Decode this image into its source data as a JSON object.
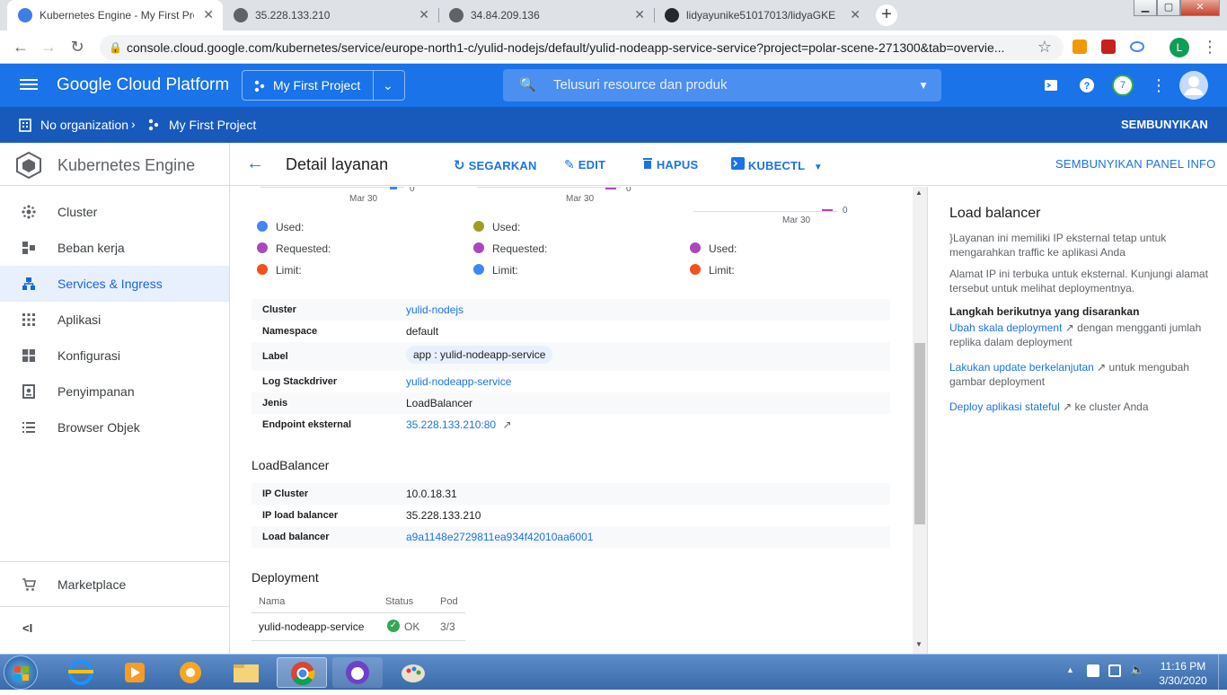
{
  "browser": {
    "tabs": [
      {
        "title": "Kubernetes Engine - My First Pro",
        "active": true,
        "icon": "kubernetes-icon"
      },
      {
        "title": "35.228.133.210",
        "active": false,
        "icon": "globe-icon"
      },
      {
        "title": "34.84.209.136",
        "active": false,
        "icon": "globe-icon"
      },
      {
        "title": "lidyayunike51017013/lidyaGKE",
        "active": false,
        "icon": "github-icon"
      }
    ],
    "url": "console.cloud.google.com/kubernetes/service/europe-north1-c/yulid-nodejs/default/yulid-nodeapp-service-service?project=polar-scene-271300&tab=overvie...",
    "profile_initial": "L"
  },
  "gcp_header": {
    "title": "Google Cloud Platform",
    "project": "My First Project",
    "search_placeholder": "Telusuri resource dan produk",
    "notification_count": "7"
  },
  "org_bar": {
    "organization": "No organization",
    "project": "My First Project",
    "hide_label": "SEMBUNYIKAN"
  },
  "left_nav": {
    "product": "Kubernetes Engine",
    "items": [
      {
        "label": "Cluster",
        "icon": "cluster-icon"
      },
      {
        "label": "Beban kerja",
        "icon": "workloads-icon"
      },
      {
        "label": "Services & Ingress",
        "icon": "services-icon",
        "selected": true
      },
      {
        "label": "Aplikasi",
        "icon": "apps-grid-icon"
      },
      {
        "label": "Konfigurasi",
        "icon": "config-icon"
      },
      {
        "label": "Penyimpanan",
        "icon": "storage-icon"
      },
      {
        "label": "Browser Objek",
        "icon": "list-icon"
      }
    ],
    "marketplace": "Marketplace",
    "collapse": "<I"
  },
  "toolbar": {
    "title": "Detail layanan",
    "refresh": "SEGARKAN",
    "edit": "EDIT",
    "delete": "HAPUS",
    "kubectl": "KUBECTL",
    "hide_panel": "SEMBUNYIKAN PANEL INFO"
  },
  "charts": {
    "tick_label": "Mar 30",
    "zero_label": "0",
    "legends": [
      [
        {
          "label": "Used:",
          "color": "#4285f4"
        },
        {
          "label": "Requested:",
          "color": "#ab47bc"
        },
        {
          "label": "Limit:",
          "color": "#f4511e"
        }
      ],
      [
        {
          "label": "Used:",
          "color": "#9e9d24"
        },
        {
          "label": "Requested:",
          "color": "#ab47bc"
        },
        {
          "label": "Limit:",
          "color": "#4285f4"
        }
      ],
      [
        {
          "label": "Used:",
          "color": "#ab47bc"
        },
        {
          "label": "Limit:",
          "color": "#f4511e"
        }
      ]
    ]
  },
  "details": {
    "rows": [
      {
        "key": "Cluster",
        "value": "yulid-nodejs",
        "link": true
      },
      {
        "key": "Namespace",
        "value": "default"
      },
      {
        "key": "Label",
        "value": "app : yulid-nodeapp-service",
        "chip": true
      },
      {
        "key": "Log Stackdriver",
        "value": "yulid-nodeapp-service",
        "link": true
      },
      {
        "key": "Jenis",
        "value": "LoadBalancer"
      },
      {
        "key": "Endpoint eksternal",
        "value": "35.228.133.210:80",
        "link": true,
        "external": true
      }
    ]
  },
  "loadbalancer": {
    "title": "LoadBalancer",
    "rows": [
      {
        "key": "IP Cluster",
        "value": "10.0.18.31"
      },
      {
        "key": "IP load balancer",
        "value": "35.228.133.210"
      },
      {
        "key": "Load balancer",
        "value": "a9a1148e2729811ea934f42010aa6001",
        "link": true
      }
    ]
  },
  "deployment": {
    "title": "Deployment",
    "headers": [
      "Nama",
      "Status",
      "Pod"
    ],
    "row": {
      "name": "yulid-nodeapp-service",
      "status": "OK",
      "pod": "3/3"
    }
  },
  "info_panel": {
    "title": "Load balancer",
    "p1": "}Layanan ini memiliki IP eksternal tetap untuk mengarahkan traffic ke aplikasi Anda",
    "p2": "Alamat IP ini terbuka untuk eksternal. Kunjungi alamat tersebut untuk melihat deploymentnya.",
    "next_steps": "Langkah berikutnya yang disarankan",
    "link1": "Ubah skala deployment",
    "text1": "dengan mengganti jumlah replika dalam deployment",
    "link2": "Lakukan update berkelanjutan",
    "text2": "untuk mengubah gambar deployment",
    "link3": "Deploy aplikasi stateful",
    "text3": "ke cluster Anda"
  },
  "taskbar": {
    "time": "11:16 PM",
    "date": "3/30/2020"
  }
}
